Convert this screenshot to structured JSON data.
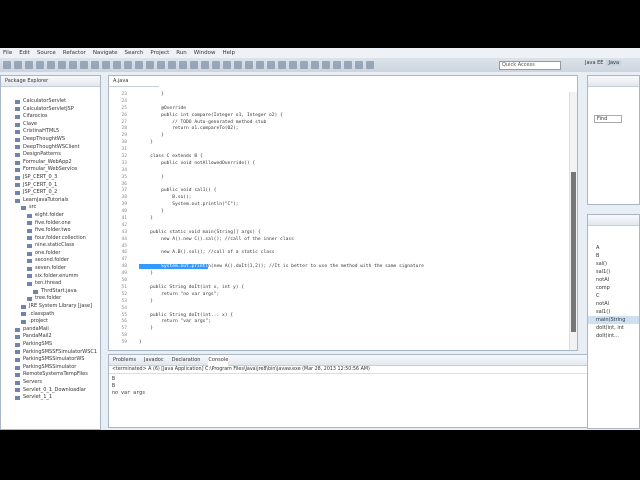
{
  "menu": [
    "File",
    "Edit",
    "Source",
    "Refactor",
    "Navigate",
    "Search",
    "Project",
    "Run",
    "Window",
    "Help"
  ],
  "quick_access": "Quick Access",
  "perspectives": [
    "Java EE",
    "Java"
  ],
  "package_explorer": {
    "title": "Package Explorer",
    "items": [
      {
        "label": "CalculatorServlet",
        "depth": 0
      },
      {
        "label": "CalculatorServletJSP",
        "depth": 0
      },
      {
        "label": "Cifarocios",
        "depth": 0
      },
      {
        "label": "Clave",
        "depth": 0
      },
      {
        "label": "CristinaHTML5",
        "depth": 0
      },
      {
        "label": "DeepThoughtWS",
        "depth": 0
      },
      {
        "label": "DeepThoughtWSClient",
        "depth": 0
      },
      {
        "label": "DesignPatterns",
        "depth": 0
      },
      {
        "label": "Formular_WebApp2",
        "depth": 0
      },
      {
        "label": "Formular_WebService",
        "depth": 0
      },
      {
        "label": "JSP_CERT_0_3",
        "depth": 0
      },
      {
        "label": "JSP_CERT_0_1",
        "depth": 0
      },
      {
        "label": "JSP_CERT_0_2",
        "depth": 0
      },
      {
        "label": "LearnJavaTutorials",
        "depth": 0
      },
      {
        "label": "src",
        "depth": 1
      },
      {
        "label": "eight.folder",
        "depth": 2
      },
      {
        "label": "five.folder.one",
        "depth": 2
      },
      {
        "label": "five.folder.two",
        "depth": 2
      },
      {
        "label": "four.folder.collection",
        "depth": 2
      },
      {
        "label": "nine.staticClass",
        "depth": 2
      },
      {
        "label": "one.folder",
        "depth": 2
      },
      {
        "label": "second.folder",
        "depth": 2
      },
      {
        "label": "seven.folder",
        "depth": 2
      },
      {
        "label": "six.folder.enumm",
        "depth": 2
      },
      {
        "label": "ten.thread",
        "depth": 2
      },
      {
        "label": "ThrdStart.java",
        "depth": 3
      },
      {
        "label": "tree.folder",
        "depth": 2
      },
      {
        "label": "JRE System Library [jase]",
        "depth": 1
      },
      {
        "label": ".classpath",
        "depth": 1
      },
      {
        "label": ".project",
        "depth": 1
      },
      {
        "label": "pandaMail",
        "depth": 0
      },
      {
        "label": "PandaMail2",
        "depth": 0
      },
      {
        "label": "ParkingSMS",
        "depth": 0
      },
      {
        "label": "ParkingSMSSFSimulatorWSC1",
        "depth": 0
      },
      {
        "label": "ParkingSMSSimulatorWS",
        "depth": 0
      },
      {
        "label": "ParkingSMSSimulator",
        "depth": 0
      },
      {
        "label": "RemoteSystemsTempFiles",
        "depth": 0
      },
      {
        "label": "Servers",
        "depth": 0
      },
      {
        "label": "Servlet_0_1_Downloadlar",
        "depth": 0
      },
      {
        "label": "Servlet_1_1",
        "depth": 0
      }
    ]
  },
  "editor": {
    "tab": "A.java",
    "lines": [
      {
        "n": "23",
        "t": "        }"
      },
      {
        "n": "24",
        "t": ""
      },
      {
        "n": "25",
        "t": "        @Override"
      },
      {
        "n": "26",
        "t": "        public int compare(Integer o1, Integer o2) {"
      },
      {
        "n": "27",
        "t": "            // TODO Auto-generated method stub"
      },
      {
        "n": "28",
        "t": "            return o1.compareTo(02);"
      },
      {
        "n": "29",
        "t": "        }"
      },
      {
        "n": "30",
        "t": "    }"
      },
      {
        "n": "31",
        "t": ""
      },
      {
        "n": "32",
        "t": "    class C extends B {"
      },
      {
        "n": "33",
        "t": "        public void notAllowedOverride() {"
      },
      {
        "n": "34",
        "t": ""
      },
      {
        "n": "35",
        "t": "        }"
      },
      {
        "n": "36",
        "t": ""
      },
      {
        "n": "37",
        "t": "        public void sal1() {"
      },
      {
        "n": "38",
        "t": "            B.so();"
      },
      {
        "n": "39",
        "t": "            System.out.println(\"C\");"
      },
      {
        "n": "40",
        "t": "        }"
      },
      {
        "n": "41",
        "t": "    }"
      },
      {
        "n": "42",
        "t": ""
      },
      {
        "n": "43",
        "t": "    public static void main(String[] args) {"
      },
      {
        "n": "44",
        "t": "        new A().new C().sal(); //call of the inner class"
      },
      {
        "n": "45",
        "t": ""
      },
      {
        "n": "46",
        "t": "        new A.B().sol(); //call of a static class"
      },
      {
        "n": "47",
        "t": ""
      },
      {
        "n": "48",
        "t": "        System.out.println(new A().doIt(1,2)); //It is better to use the method with the same signature",
        "sel": "        System.out.printl"
      },
      {
        "n": "49",
        "t": "    }"
      },
      {
        "n": "50",
        "t": ""
      },
      {
        "n": "51",
        "t": "    public String doIt(int x, int y) {"
      },
      {
        "n": "52",
        "t": "        return \"no var args\";"
      },
      {
        "n": "53",
        "t": "    }"
      },
      {
        "n": "54",
        "t": ""
      },
      {
        "n": "55",
        "t": "    public String doIt(int... x) {"
      },
      {
        "n": "56",
        "t": "        return \"var args\";"
      },
      {
        "n": "57",
        "t": "    }"
      },
      {
        "n": "58",
        "t": ""
      },
      {
        "n": "59",
        "t": "}"
      }
    ]
  },
  "console": {
    "tabs": [
      "Problems",
      "Javadoc",
      "Declaration",
      "Console"
    ],
    "status": "<terminated> A (6) [Java Application] C:\\Program Files\\Java\\jre8\\bin\\javaw.exe (Mar 28, 2013 12:50:56 AM)",
    "output": [
      "B",
      "B",
      "no var args"
    ]
  },
  "right_panel": {
    "find": "Find"
  },
  "outline": {
    "items": [
      "A",
      "B",
      "sal()",
      "sal1()",
      "notAl",
      "comp",
      "C",
      "notAl",
      "sal1()",
      "main(String",
      "doIt(int, int",
      "doIt(int..."
    ]
  }
}
